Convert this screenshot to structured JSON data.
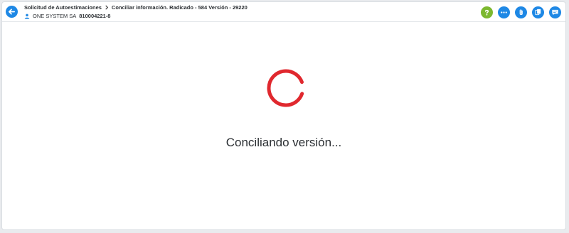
{
  "header": {
    "breadcrumb": {
      "item1": "Solicitud de Autoestimaciones",
      "item2": "Conciliar información. Radicado - 584 Versión - 29220"
    },
    "user": {
      "name": "ONE SYSTEM SA",
      "nit": "810004221-8"
    },
    "actions": [
      {
        "icon": "help-icon",
        "color": "#7cb82f"
      },
      {
        "icon": "more-icon",
        "color": "#1e88e5"
      },
      {
        "icon": "attachment-icon",
        "color": "#1e88e5"
      },
      {
        "icon": "copy-icon",
        "color": "#1e88e5"
      },
      {
        "icon": "comment-icon",
        "color": "#1e88e5"
      }
    ]
  },
  "main": {
    "loading_text": "Conciliando versión...",
    "spinner_color": "#e0282e"
  }
}
